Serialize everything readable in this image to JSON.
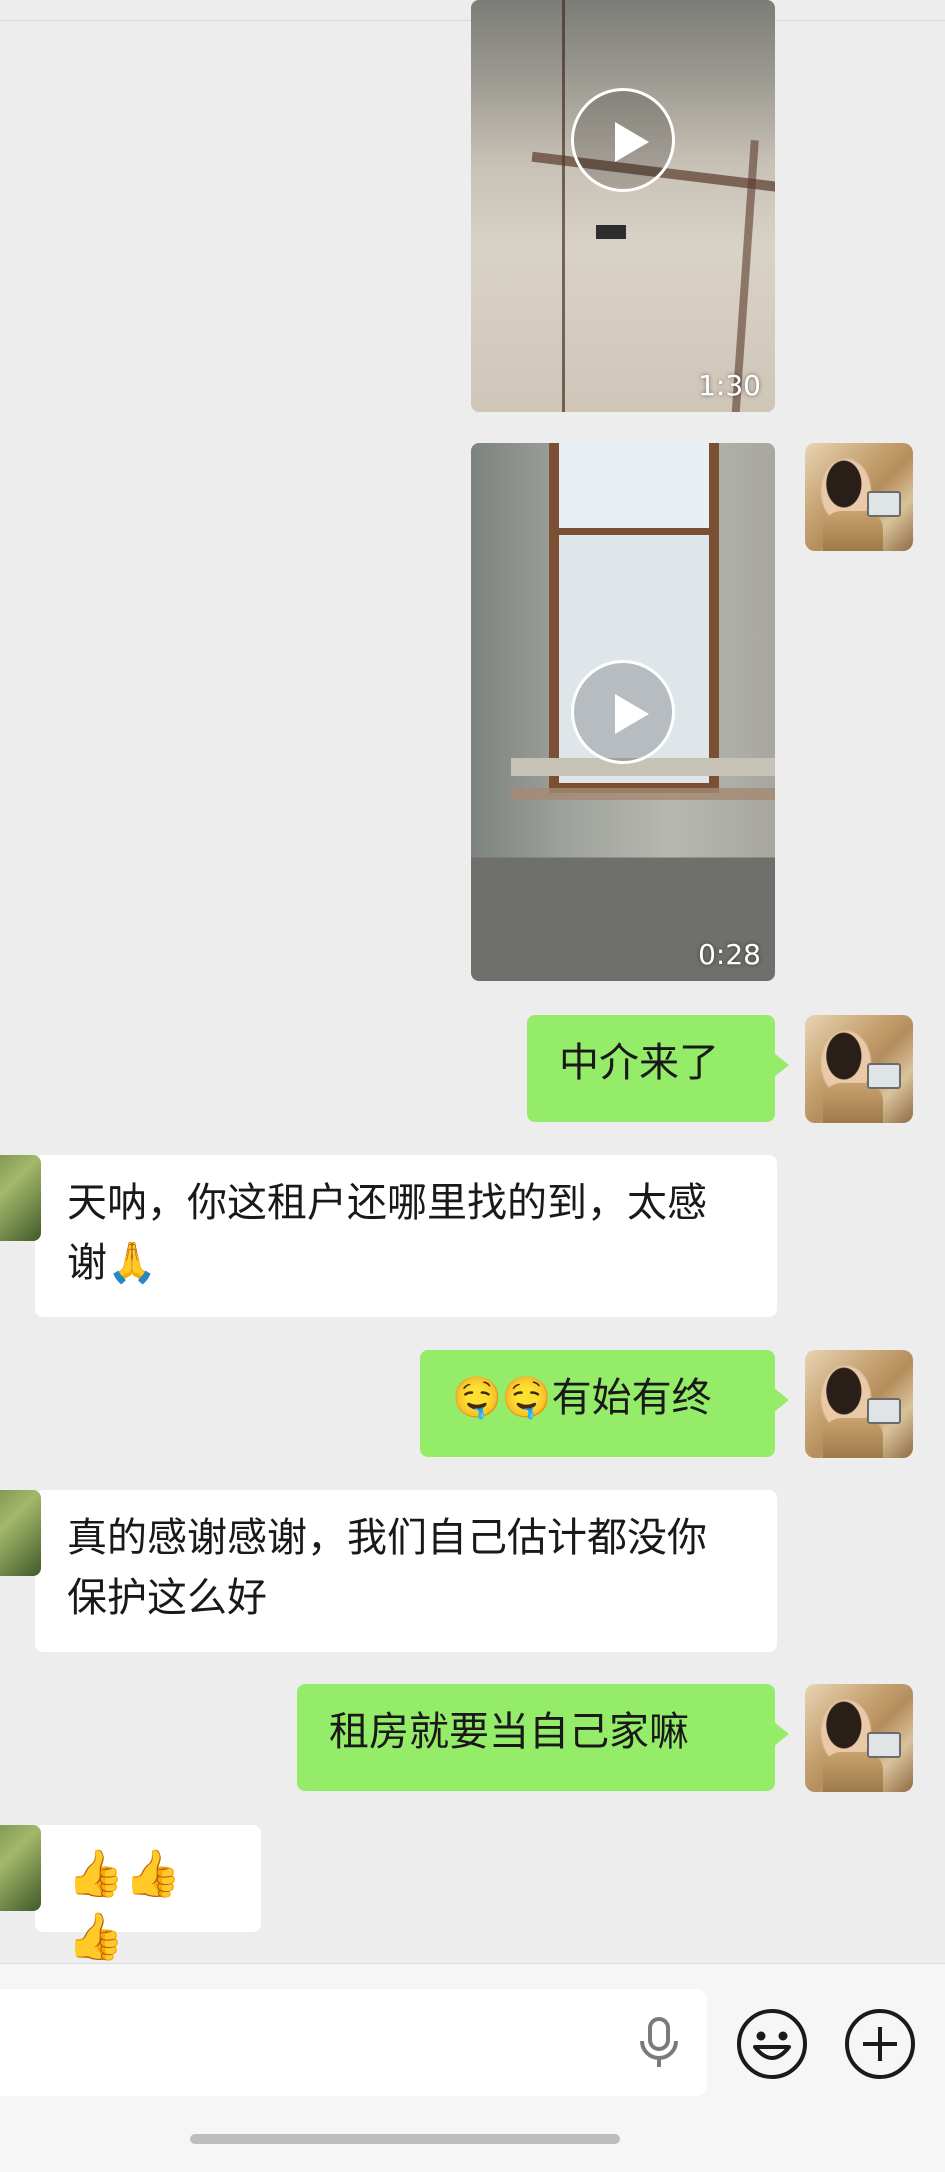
{
  "messages": {
    "video1": {
      "duration": "1:30"
    },
    "video2": {
      "duration": "0:28"
    },
    "msg1": {
      "text": "中介来了"
    },
    "msg2": {
      "text": "天呐，你这租户还哪里找的到，太感谢🙏"
    },
    "msg3": {
      "text": "🤤🤤有始有终"
    },
    "msg4": {
      "text": "真的感谢感谢，我们自己估计都没你保护这么好"
    },
    "msg5": {
      "text": "租房就要当自己家嘛"
    },
    "msg6": {
      "text": "👍👍👍"
    }
  },
  "input_bar": {
    "placeholder": "",
    "icons": [
      "mic-icon",
      "emoji-icon",
      "plus-icon"
    ]
  },
  "colors": {
    "my_bubble": "#95ec69",
    "their_bubble": "#ffffff",
    "background": "#ededed"
  }
}
